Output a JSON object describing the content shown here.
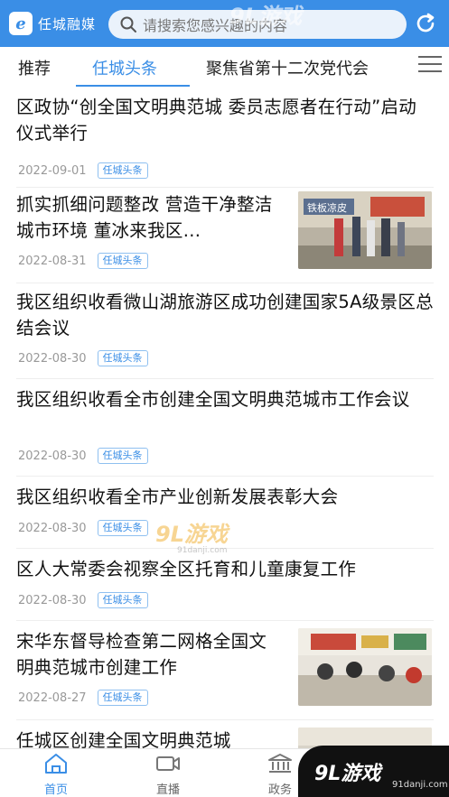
{
  "app": {
    "logo_text": "任城融媒",
    "search_placeholder": "请搜索您感兴趣的内容"
  },
  "tabs": [
    "推荐",
    "任城头条",
    "聚焦省第十二次党代会"
  ],
  "active_tab": "任城头条",
  "articles": [
    {
      "title": "区政协“创全国文明典范城 委员志愿者在行动”启动仪式举行",
      "date": "2022-09-01",
      "tag": "任城头条",
      "has_thumb": false
    },
    {
      "title": "抓实抓细问题整改 营造干净整洁城市环境 董冰来我区...",
      "date": "2022-08-31",
      "tag": "任城头条",
      "has_thumb": true,
      "thumb_sign": "铁板凉皮"
    },
    {
      "title": "我区组织收看微山湖旅游区成功创建国家5A级景区总结会议",
      "date": "2022-08-30",
      "tag": "任城头条",
      "has_thumb": false
    },
    {
      "title": "我区组织收看全市创建全国文明典范城市工作会议",
      "date": "2022-08-30",
      "tag": "任城头条",
      "has_thumb": false
    },
    {
      "title": "我区组织收看全市产业创新发展表彰大会",
      "date": "2022-08-30",
      "tag": "任城头条",
      "has_thumb": false
    },
    {
      "title": "区人大常委会视察全区托育和儿童康复工作",
      "date": "2022-08-30",
      "tag": "任城头条",
      "has_thumb": false
    },
    {
      "title": "宋华东督导检查第二网格全国文明典范城市创建工作",
      "date": "2022-08-27",
      "tag": "任城头条",
      "has_thumb": true
    },
    {
      "title": "任城区创建全国文明典范城",
      "date": "",
      "tag": "",
      "has_thumb": true
    }
  ],
  "bottom_nav": [
    {
      "label": "首页",
      "icon": "home-icon",
      "active": true
    },
    {
      "label": "直播",
      "icon": "video-icon",
      "active": false
    },
    {
      "label": "政务",
      "icon": "government-icon",
      "active": false
    }
  ],
  "watermark": {
    "brand": "9L游戏",
    "site": "91danji.com"
  },
  "colors": {
    "accent": "#3a8ee6",
    "tag_border": "#8fc0f0"
  }
}
